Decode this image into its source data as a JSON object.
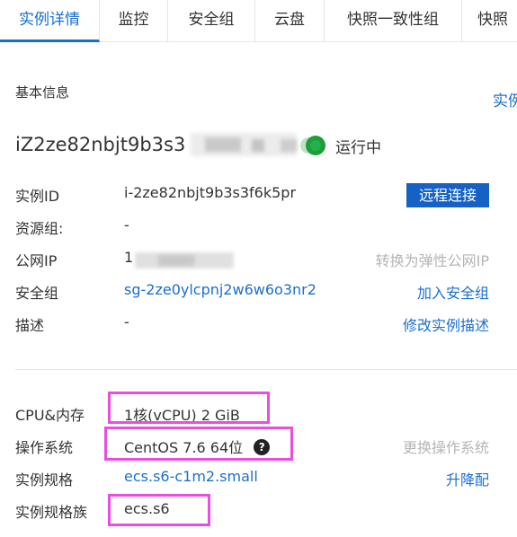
{
  "tabs": [
    {
      "label": "实例详情",
      "active": true
    },
    {
      "label": "监控"
    },
    {
      "label": "安全组"
    },
    {
      "label": "云盘"
    },
    {
      "label": "快照一致性组"
    },
    {
      "label": "快照"
    }
  ],
  "basic_info": {
    "title": "基本信息",
    "top_right_link": "实例",
    "instance_name_visible": "iZ2ze82nbjt9b3s3",
    "status": "运行中",
    "remote_connect_button": "远程连接"
  },
  "details": [
    {
      "label": "实例ID",
      "value": "i-2ze82nbjt9b3s3f6k5pr",
      "value_is_link": false,
      "action": ""
    },
    {
      "label": "资源组:",
      "value": "-",
      "value_is_link": false,
      "action": ""
    },
    {
      "label": "公网IP",
      "value": "1",
      "value_is_link": false,
      "action": "转换为弹性公网IP",
      "action_disabled": true
    },
    {
      "label": "安全组",
      "value": "sg-2ze0ylcpnj2w6w6o3nr2",
      "value_is_link": true,
      "action": "加入安全组"
    },
    {
      "label": "描述",
      "value": "-",
      "value_is_link": false,
      "action": "修改实例描述"
    }
  ],
  "config": [
    {
      "label": "CPU&内存",
      "value": "1核(vCPU) 2 GiB",
      "value_is_link": false,
      "action": ""
    },
    {
      "label": "操作系统",
      "value": "CentOS 7.6 64位",
      "value_is_link": false,
      "action": "更换操作系统",
      "action_disabled": true
    },
    {
      "label": "实例规格",
      "value": "ecs.s6-c1m2.small",
      "value_is_link": true,
      "action": "升降配"
    },
    {
      "label": "实例规格族",
      "value": "ecs.s6",
      "value_is_link": false,
      "action": ""
    }
  ],
  "colors": {
    "accent": "#1a6fd0",
    "button": "#1562c4",
    "status_green": "#1f9d3a",
    "highlight": "#e94ee0"
  },
  "icons": {
    "status": "running-status-icon",
    "os_help": "question-circle-icon"
  }
}
